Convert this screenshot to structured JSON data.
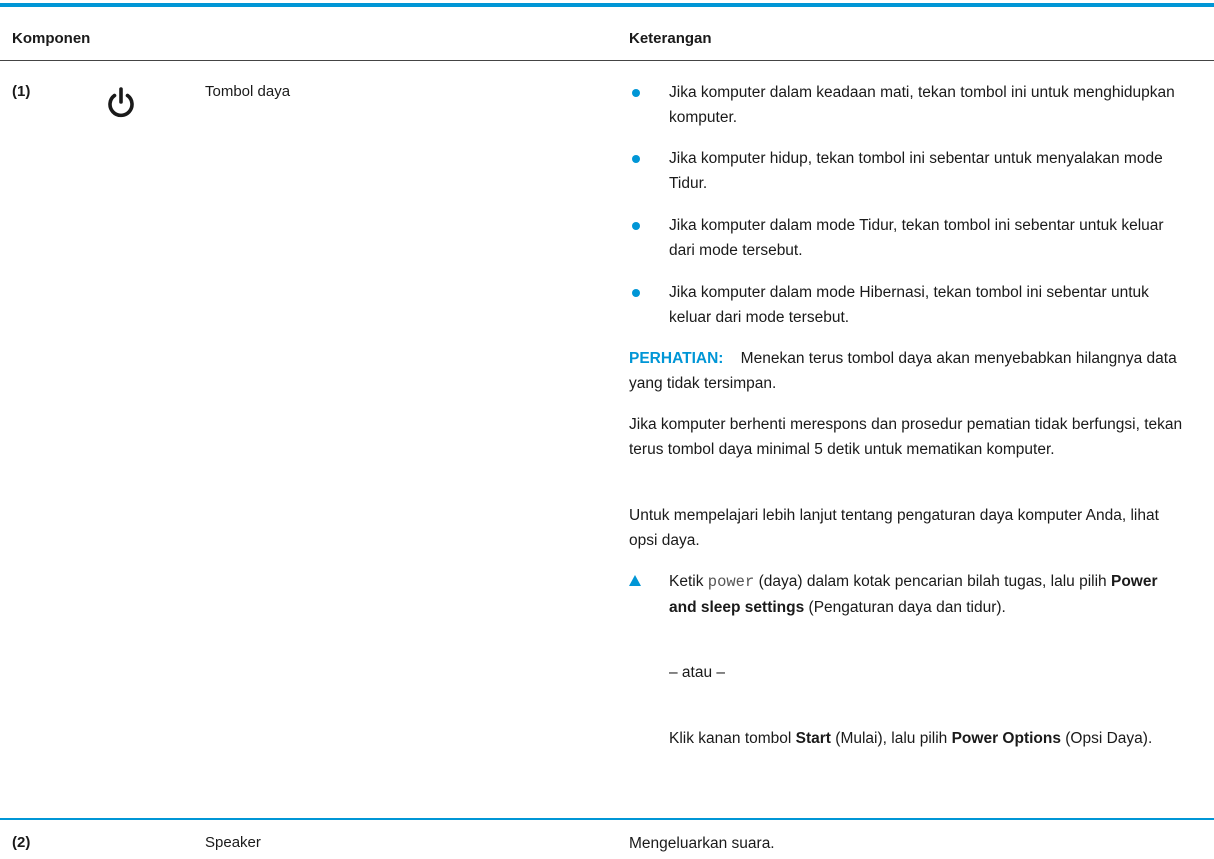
{
  "table": {
    "header": {
      "component": "Komponen",
      "description": "Keterangan"
    },
    "row1": {
      "num": "(1)",
      "icon": "power-icon",
      "name": "Tombol daya",
      "bullets": [
        "Jika komputer dalam keadaan mati, tekan tombol ini untuk menghidupkan komputer.",
        "Jika komputer hidup, tekan tombol ini sebentar untuk menyalakan mode Tidur.",
        "Jika komputer dalam mode Tidur, tekan tombol ini sebentar untuk keluar dari mode tersebut.",
        "Jika komputer dalam mode Hibernasi, tekan tombol ini sebentar untuk keluar dari mode tersebut."
      ],
      "caution_label": "PERHATIAN:",
      "caution_text": "Menekan terus tombol daya akan menyebabkan hilangnya data yang tidak tersimpan.",
      "para1": "Jika komputer berhenti merespons dan prosedur pematian tidak berfungsi, tekan terus tombol daya minimal 5 detik untuk mematikan komputer.",
      "para2": "Untuk mempelajari lebih lanjut tentang pengaturan daya komputer Anda, lihat opsi daya.",
      "step": {
        "a": "Ketik ",
        "code": "power",
        "b": " (daya) dalam kotak pencarian bilah tugas, lalu pilih ",
        "bold": "Power and sleep settings",
        "c": " (Pengaturan daya dan tidur)."
      },
      "or": "– atau –",
      "alt": {
        "a": "Klik kanan tombol ",
        "bold1": "Start",
        "b": " (Mulai), lalu pilih ",
        "bold2": "Power Options",
        "c": " (Opsi Daya)."
      }
    },
    "row2": {
      "num": "(2)",
      "name": "Speaker",
      "description": "Mengeluarkan suara."
    }
  },
  "colors": {
    "accent": "#0096d6"
  }
}
